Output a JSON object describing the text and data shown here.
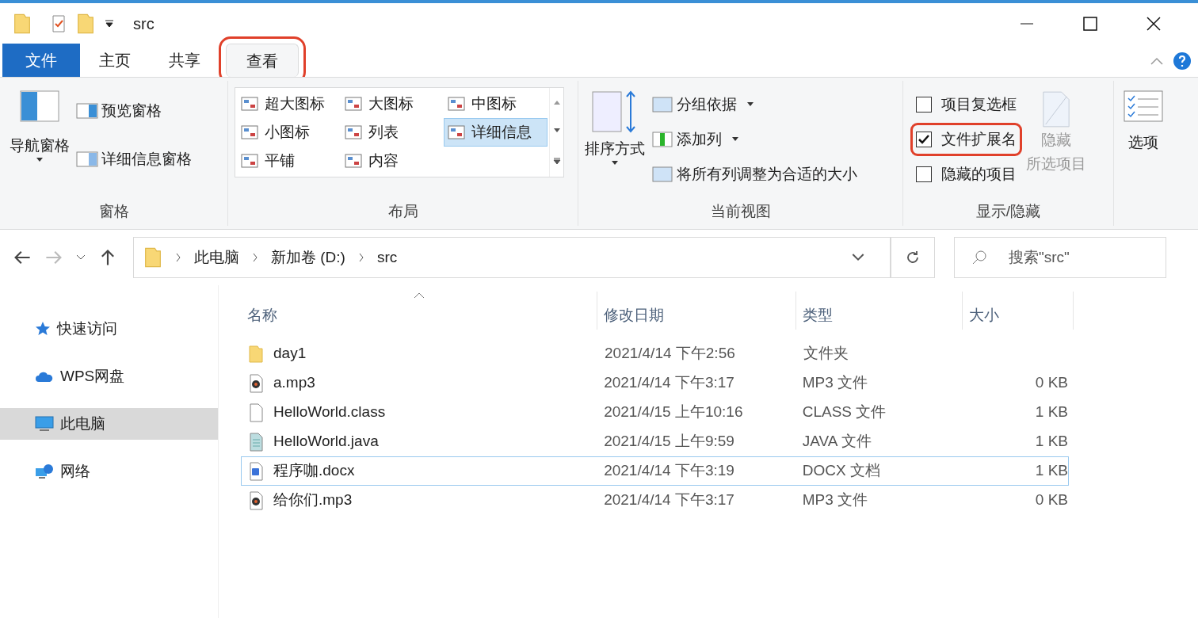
{
  "window": {
    "title": "src"
  },
  "tabs": [
    {
      "label": "文件",
      "kind": "file",
      "selected": false,
      "highlighted": false
    },
    {
      "label": "主页",
      "kind": "normal",
      "selected": false,
      "highlighted": false
    },
    {
      "label": "共享",
      "kind": "normal",
      "selected": false,
      "highlighted": false
    },
    {
      "label": "查看",
      "kind": "normal",
      "selected": true,
      "highlighted": true
    }
  ],
  "ribbon": {
    "panes": {
      "large": {
        "label": "导航窗格"
      },
      "items": [
        {
          "label": "预览窗格"
        },
        {
          "label": "详细信息窗格"
        }
      ],
      "caption": "窗格"
    },
    "layout": {
      "options": [
        {
          "label": "超大图标",
          "selected": false
        },
        {
          "label": "大图标",
          "selected": false
        },
        {
          "label": "中图标",
          "selected": false
        },
        {
          "label": "小图标",
          "selected": false
        },
        {
          "label": "列表",
          "selected": false
        },
        {
          "label": "详细信息",
          "selected": true
        },
        {
          "label": "平铺",
          "selected": false
        },
        {
          "label": "内容",
          "selected": false
        }
      ],
      "caption": "布局"
    },
    "current_view": {
      "large": {
        "label": "排序方式"
      },
      "items": [
        {
          "label": "分组依据",
          "dropdown": true
        },
        {
          "label": "添加列",
          "dropdown": true
        },
        {
          "label": "将所有列调整为合适的大小",
          "dropdown": false
        }
      ],
      "caption": "当前视图"
    },
    "show_hide": {
      "checkboxes": [
        {
          "label": "项目复选框",
          "checked": false,
          "highlighted": false
        },
        {
          "label": "文件扩展名",
          "checked": true,
          "highlighted": true
        },
        {
          "label": "隐藏的项目",
          "checked": false,
          "highlighted": false
        }
      ],
      "hide_selected": {
        "lines": [
          "隐藏",
          "所选项目"
        ],
        "disabled": true
      },
      "caption": "显示/隐藏"
    },
    "options": {
      "label": "选项"
    }
  },
  "address_bar": {
    "segments": [
      "此电脑",
      "新加卷 (D:)",
      "src"
    ],
    "forward_disabled": true
  },
  "search": {
    "placeholder": "搜索\"src\""
  },
  "sidebar": {
    "items": [
      {
        "label": "快速访问",
        "kind": "star",
        "selected": false
      },
      {
        "label": "WPS网盘",
        "kind": "cloud",
        "selected": false
      },
      {
        "label": "此电脑",
        "kind": "computer",
        "selected": true
      },
      {
        "label": "网络",
        "kind": "network",
        "selected": false
      }
    ]
  },
  "table": {
    "columns": [
      "名称",
      "修改日期",
      "类型",
      "大小"
    ],
    "rows": [
      {
        "kind": "folder",
        "name": "day1",
        "date": "2021/4/14 下午2:56",
        "type": "文件夹",
        "focused": false
      },
      {
        "kind": "audio",
        "name": "a.mp3",
        "date": "2021/4/14 下午3:17",
        "type": "MP3 文件",
        "size": "0 KB",
        "focused": false
      },
      {
        "kind": "blank",
        "name": "HelloWorld.class",
        "date": "2021/4/15 上午10:16",
        "type": "CLASS 文件",
        "size": "1 KB",
        "focused": false
      },
      {
        "kind": "text",
        "name": "HelloWorld.java",
        "date": "2021/4/15 上午9:59",
        "type": "JAVA 文件",
        "size": "1 KB",
        "focused": false
      },
      {
        "kind": "word",
        "name": "程序咖.docx",
        "date": "2021/4/14 下午3:19",
        "type": "DOCX 文档",
        "size": "1 KB",
        "focused": true
      },
      {
        "kind": "audio",
        "name": "给你们.mp3",
        "date": "2021/4/14 下午3:17",
        "type": "MP3 文件",
        "size": "0 KB",
        "focused": false
      }
    ]
  }
}
